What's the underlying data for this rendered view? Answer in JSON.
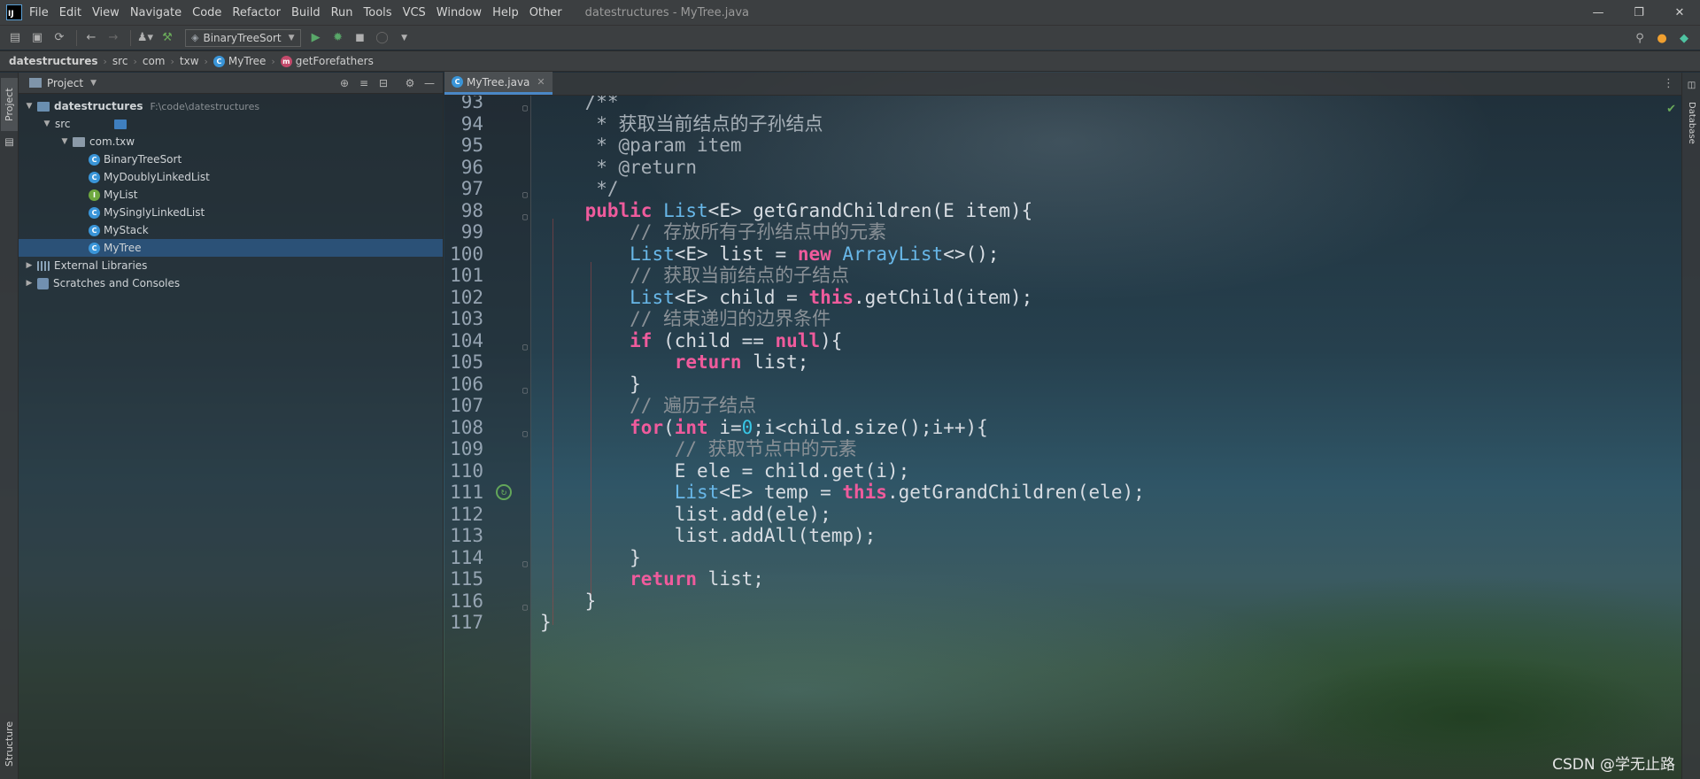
{
  "window": {
    "title": "datestructures - MyTree.java",
    "logo": "IJ",
    "controls": [
      "—",
      "❐",
      "✕"
    ]
  },
  "menu": [
    "File",
    "Edit",
    "View",
    "Navigate",
    "Code",
    "Refactor",
    "Build",
    "Run",
    "Tools",
    "VCS",
    "Window",
    "Help",
    "Other"
  ],
  "toolbar": {
    "run_config": "BinaryTreeSort"
  },
  "breadcrumb": [
    "datestructures",
    "src",
    "com",
    "txw",
    "MyTree",
    "getForefathers"
  ],
  "project": {
    "panel_title": "Project",
    "root_name": "datestructures",
    "root_path": "F:\\code\\datestructures",
    "src": "src",
    "package": "com.txw",
    "files": [
      {
        "name": "BinaryTreeSort",
        "kind": "class"
      },
      {
        "name": "MyDoublyLinkedList",
        "kind": "class"
      },
      {
        "name": "MyList",
        "kind": "interface"
      },
      {
        "name": "MySinglyLinkedList",
        "kind": "class"
      },
      {
        "name": "MyStack",
        "kind": "class"
      },
      {
        "name": "MyTree",
        "kind": "class",
        "selected": true
      }
    ],
    "external_libraries": "External Libraries",
    "scratches": "Scratches and Consoles"
  },
  "side_tabs": {
    "left_top": "Project",
    "left_bottom": "Structure",
    "right_top": "Database"
  },
  "editor": {
    "tab": "MyTree.java",
    "lines": [
      {
        "n": "93",
        "text": "    /**"
      },
      {
        "n": "94",
        "text": "     * 获取当前结点的子孙结点"
      },
      {
        "n": "95",
        "text": "     * @param item"
      },
      {
        "n": "96",
        "text": "     * @return"
      },
      {
        "n": "97",
        "text": "     */"
      },
      {
        "n": "98",
        "text": "    public List<E> getGrandChildren(E item){"
      },
      {
        "n": "99",
        "text": "        // 存放所有子孙结点中的元素"
      },
      {
        "n": "100",
        "text": "        List<E> list = new ArrayList<>();"
      },
      {
        "n": "101",
        "text": "        // 获取当前结点的子结点"
      },
      {
        "n": "102",
        "text": "        List<E> child = this.getChild(item);"
      },
      {
        "n": "103",
        "text": "        // 结束递归的边界条件"
      },
      {
        "n": "104",
        "text": "        if (child == null){"
      },
      {
        "n": "105",
        "text": "            return list;"
      },
      {
        "n": "106",
        "text": "        }"
      },
      {
        "n": "107",
        "text": "        // 遍历子结点"
      },
      {
        "n": "108",
        "text": "        for(int i=0;i<child.size();i++){"
      },
      {
        "n": "109",
        "text": "            // 获取节点中的元素"
      },
      {
        "n": "110",
        "text": "            E ele = child.get(i);"
      },
      {
        "n": "111",
        "text": "            List<E> temp = this.getGrandChildren(ele);"
      },
      {
        "n": "112",
        "text": "            list.add(ele);"
      },
      {
        "n": "113",
        "text": "            list.addAll(temp);"
      },
      {
        "n": "114",
        "text": "        }"
      },
      {
        "n": "115",
        "text": "        return list;"
      },
      {
        "n": "116",
        "text": "    }"
      },
      {
        "n": "117",
        "text": "}"
      }
    ]
  },
  "watermark": "CSDN @学无止路",
  "colors": {
    "keyword": "#ef5b9c",
    "type": "#68b7e8",
    "method": "#6f9fe8",
    "comment": "#8a9197",
    "number": "#38c7e6",
    "selection": "#2e5c8c",
    "tab_underline": "#4a88c7"
  }
}
